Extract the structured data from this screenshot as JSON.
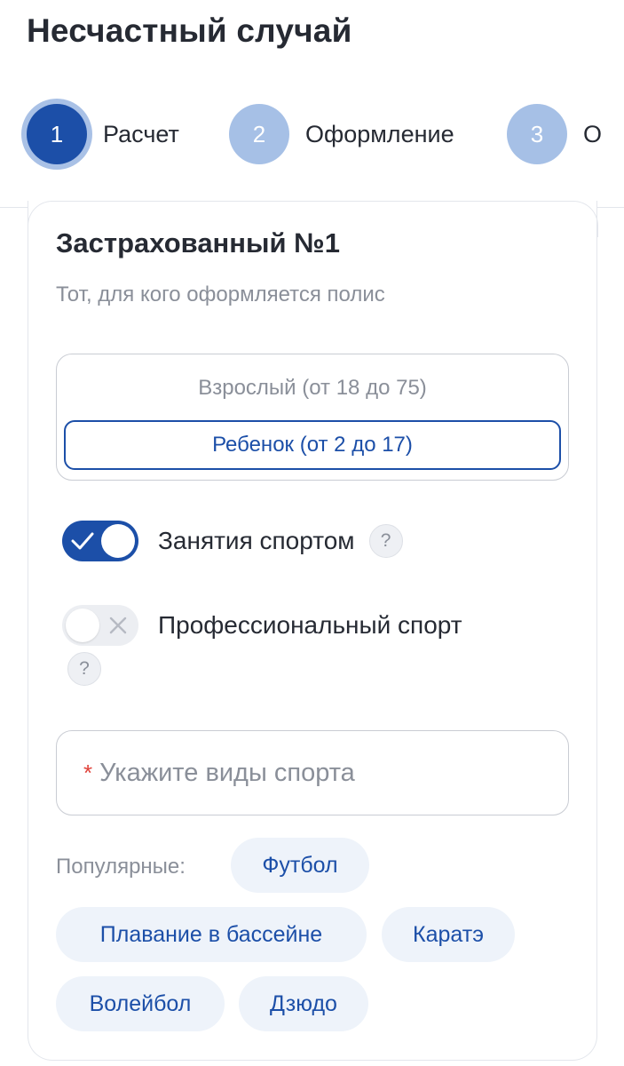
{
  "page": {
    "title": "Несчастный случай"
  },
  "stepper": {
    "steps": [
      {
        "number": "1",
        "label": "Расчет",
        "state": "active"
      },
      {
        "number": "2",
        "label": "Оформление",
        "state": "inactive"
      },
      {
        "number": "3",
        "label": "О",
        "state": "inactive"
      }
    ]
  },
  "insured": {
    "title": "Застрахованный №1",
    "subtitle": "Тот, для кого оформляется полис",
    "age_options": [
      {
        "label": "Взрослый (от 18 до 75)",
        "selected": false
      },
      {
        "label": "Ребенок (от 2 до 17)",
        "selected": true
      }
    ],
    "sport_toggle": {
      "label": "Занятия спортом",
      "on": true,
      "help": "?"
    },
    "pro_sport_toggle": {
      "label": "Профессиональный спорт",
      "on": false,
      "help": "?"
    },
    "sports_input": {
      "required_mark": "*",
      "placeholder": "Укажите виды спорта",
      "value": ""
    },
    "popular": {
      "label": "Популярные:",
      "chips": [
        "Футбол",
        "Плавание в бассейне",
        "Каратэ",
        "Волейбол",
        "Дзюдо"
      ]
    }
  },
  "colors": {
    "primary": "#1c4fa8",
    "primary_light": "#a6c0e6",
    "chip_bg": "#eef3fa",
    "required": "#e0423a",
    "muted_text": "#8a8f99"
  },
  "icons": {
    "sport_toggle_mark": "check-icon",
    "pro_toggle_mark": "close-icon",
    "help": "question-icon"
  }
}
